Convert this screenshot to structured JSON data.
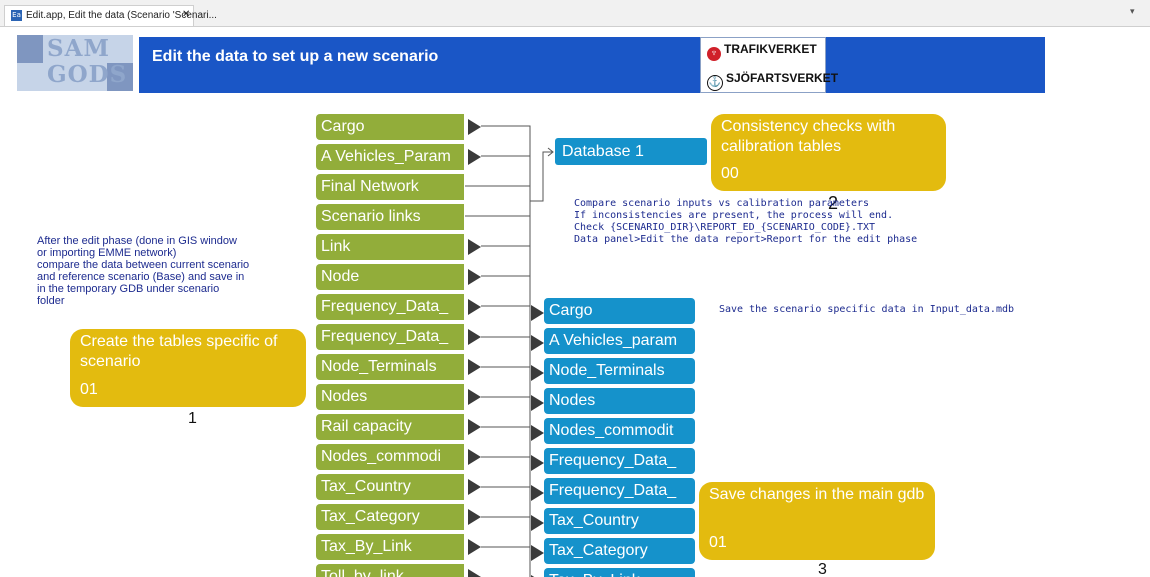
{
  "tab": {
    "icon": "Ea",
    "title": "Edit.app, Edit the data (Scenario 'Scenari...",
    "close": "✕",
    "menu": "▾"
  },
  "header": {
    "logo_top": "SAM",
    "logo_bottom": "GODS",
    "title": "Edit the data to set up a new scenario",
    "agencies": [
      "TRAFIKVERKET",
      "SJÖFARTSVERKET"
    ]
  },
  "green_items": [
    "Cargo",
    "A Vehicles_Param",
    "Final Network",
    "Scenario links",
    "Link",
    "Node",
    "Frequency_Data_",
    "Frequency_Data_",
    "Node_Terminals",
    "Nodes",
    "Rail capacity",
    "Nodes_commodi",
    "Tax_Country",
    "Tax_Category",
    "Tax_By_Link",
    "Toll_by_link"
  ],
  "blue_items": [
    "Cargo",
    "A Vehicles_param",
    "Node_Terminals",
    "Nodes",
    "Nodes_commodit",
    "Frequency_Data_",
    "Frequency_Data_",
    "Tax_Country",
    "Tax_Category",
    "Tax_By_Link"
  ],
  "database_box": "Database 1",
  "step1": {
    "title": "Create the tables specific of scenario",
    "code": "01",
    "number": "1"
  },
  "step2": {
    "title": "Consistency checks with calibration tables",
    "code": "00",
    "number": "2"
  },
  "step3": {
    "title": "Save changes in the main gdb",
    "code": "01",
    "number": "3"
  },
  "notes": {
    "left": [
      "After the edit phase (done in GIS window",
      "or importing EMME network)",
      "compare the data between current scenario",
      "and reference scenario (Base) and save in",
      "in the temporary GDB under scenario",
      "folder"
    ],
    "consistency": [
      "Compare scenario inputs vs calibration parameters",
      "If inconsistencies are present, the process will end.",
      "Check  {SCENARIO_DIR}\\REPORT_ED_{SCENARIO_CODE}.TXT",
      "Data panel>Edit the data report>Report for the edit phase"
    ],
    "save": "Save the scenario specific data in Input_data.mdb"
  },
  "colors": {
    "banner": "#1a56c6",
    "green": "#92ad3a",
    "blue": "#1592cb",
    "yellow": "#e3bb0f",
    "note_text": "#1d2b8f"
  }
}
